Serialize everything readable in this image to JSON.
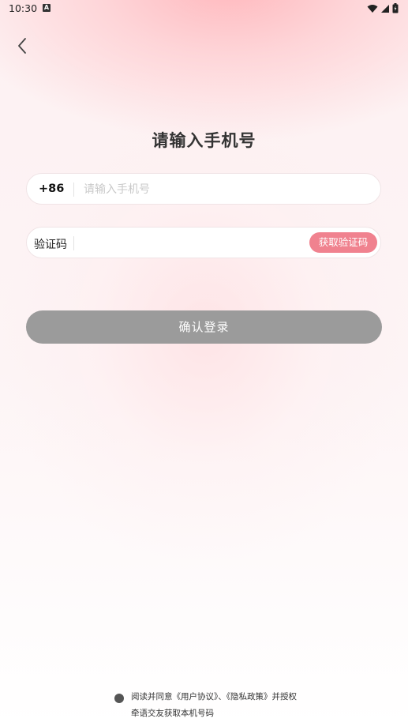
{
  "status_bar": {
    "time": "10:30",
    "notification_icon": "a-icon",
    "icons": [
      "wifi-icon",
      "signal-icon",
      "battery-icon"
    ]
  },
  "header": {
    "back_icon": "chevron-left-icon",
    "title": "请输入手机号"
  },
  "phone": {
    "prefix": "+86",
    "placeholder": "请输入手机号",
    "value": ""
  },
  "code": {
    "label": "验证码",
    "value": "",
    "get_code_label": "获取验证码"
  },
  "login": {
    "label": "确认登录"
  },
  "agreement": {
    "checked": false,
    "text": "阅读并同意《用户协议》、《隐私政策》并授权牵语交友获取本机号码"
  },
  "colors": {
    "accent": "#f0828f",
    "disabled_button": "#9b9b9b",
    "top_gradient": "#ffb8bd"
  }
}
